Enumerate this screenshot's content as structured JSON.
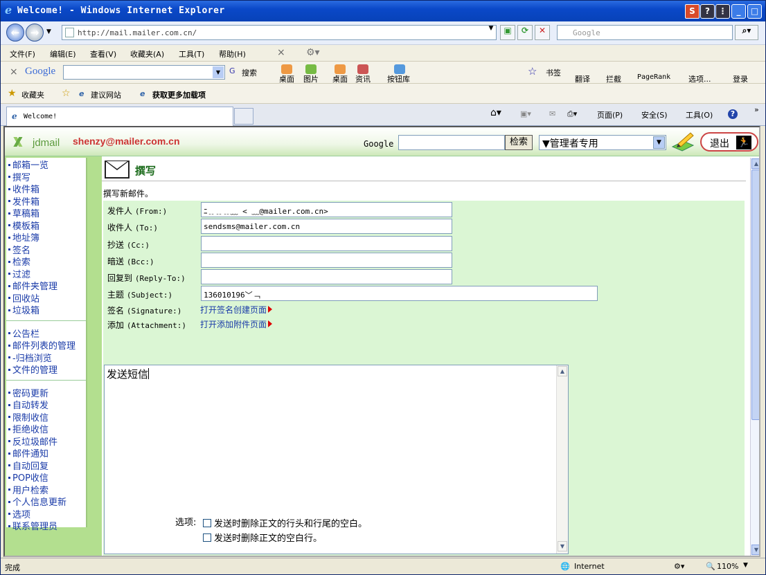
{
  "window": {
    "title": "Welcome! - Windows Internet Explorer"
  },
  "address": {
    "url": "http://mail.mailer.com.cn/",
    "search_placeholder": "Google"
  },
  "menu": [
    "文件(F)",
    "编辑(E)",
    "查看(V)",
    "收藏夹(A)",
    "工具(T)",
    "帮助(H)"
  ],
  "gtoolbar": {
    "brand": "Google",
    "search": "搜索",
    "items": [
      "桌面",
      "图片",
      "桌面",
      "资讯",
      "按钮库"
    ],
    "right": [
      "书签",
      "翻译",
      "拦截",
      "PageRank",
      "选项...",
      "登录"
    ]
  },
  "favorites": {
    "label": "收藏夹",
    "items": [
      "建议网站",
      "获取更多加载项"
    ]
  },
  "tab": {
    "label": "Welcome!"
  },
  "commandbar": [
    "页面(P)",
    "安全(S)",
    "工具(O)"
  ],
  "header": {
    "logo": "jdmail",
    "user": "shenzy@mailer.com.cn",
    "google_label": "Google",
    "search_button": "检索",
    "admin_select": "▼管理者专用",
    "logout": "退出"
  },
  "nav": {
    "group1": [
      "邮箱一览",
      "撰写",
      "收件箱",
      "发件箱",
      "草稿箱",
      "模板箱",
      "地址簿",
      "签名",
      "检索",
      "过滤",
      "邮件夹管理",
      "回收站",
      "垃圾箱"
    ],
    "group2": [
      "公告栏",
      "邮件列表的管理",
      "-归档浏览",
      "文件的管理"
    ],
    "group3": [
      "密码更新",
      "自动转发",
      "限制收信",
      "拒绝收信",
      "反垃圾邮件",
      "邮件通知",
      "自动回复",
      "POP收信",
      "用户检索",
      "个人信息更新",
      "选项",
      "联系管理员"
    ]
  },
  "compose": {
    "title": "撰写",
    "subtitle": "撰写新邮件。",
    "fields": {
      "from_label": "发件人",
      "from_hint": "(From:)",
      "from_value": "ﾆ﹎﹎﹎﹏ <        ﹏@mailer.com.cn>",
      "to_label": "收件人",
      "to_hint": "(To:)",
      "to_value": "sendsms@mailer.com.cn",
      "cc_label": "抄送",
      "cc_hint": "(Cc:)",
      "cc_value": "",
      "bcc_label": "暗送",
      "bcc_hint": "(Bcc:)",
      "bcc_value": "",
      "replyto_label": "回复到",
      "replyto_hint": "(Reply-To:)",
      "replyto_value": "",
      "subject_label": "主题",
      "subject_hint": "(Subject:)",
      "subject_value": "136010196﹀﹁",
      "sig_label": "签名",
      "sig_hint": "(Signature:)",
      "sig_link": "打开签名创建页面",
      "att_label": "添加",
      "att_hint": "(Attachment:)",
      "att_link": "打开添加附件页面"
    },
    "body": "发送短信",
    "options_label": "选项:",
    "options": [
      "发送时删除正文的行头和行尾的空白。",
      "发送时删除正文的空白行。"
    ]
  },
  "status": {
    "left": "完成",
    "zone": "Internet",
    "zoom": "110%"
  },
  "colors": {
    "titlebar": "#0a48c8",
    "nav_link": "#1a3ba8",
    "form_bg": "#dbf6d4",
    "user_red": "#cc3333"
  }
}
